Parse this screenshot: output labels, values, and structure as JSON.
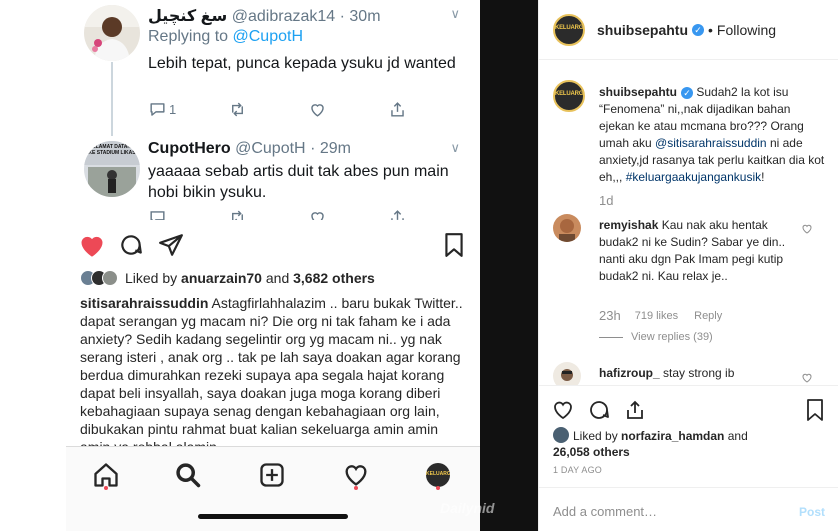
{
  "tweets": [
    {
      "name": "سغ كنچيل",
      "handle": "@adibrazak14",
      "time": "· 30m",
      "reply_prefix": "Replying to ",
      "reply_to": "@CupotH",
      "text": "Lebih tepat, punca kepada ysuku jd wanted",
      "replies": "1"
    },
    {
      "name": "CupotHero",
      "handle": "@CupotH",
      "time": "· 29m",
      "text": "yaaaaa sebab artis duit tak abes pun main hobi bikin ysuku.",
      "avatar_text": "SELAMAT DATANG KE STADIUM LIKAS"
    }
  ],
  "phone_post": {
    "liked_by_prefix": "Liked by ",
    "liked_user": "anuarzain70",
    "liked_and": " and ",
    "liked_count": "3,682 others",
    "caption_user": "sitisarahraissuddin",
    "caption_text": " Astagfirlahhalazim .. baru bukak Twitter.. dapat serangan yg macam ni? Die org ni tak faham ke i ada anxiety?  Sedih kadang segelintir org yg macam ni.. yg nak serang isteri , anak org .. tak pe lah saya doakan agar korang berdua dimurahkan rezeki supaya apa segala hajat korang dapat beli insyallah, saya doakan juga moga korang diberi kebahagiaan supaya  senag dengan kebahagiaan org lain, dibukakan pintu rahmat buat kalian sekeluarga amin amin amin ya robbal alamin..",
    "nav_logo": "KELUARGA"
  },
  "watermark": "Dailynid",
  "right_panel": {
    "header_user": "shuibsepahtu",
    "following_sep": " • ",
    "following": "Following",
    "logo_text": "KELUARGA",
    "caption_user": "shuibsepahtu",
    "caption_text_1": " Sudah2 la kot isu “Fenomena” ni,,nak dijadikan bahan ejekan ke atau mcmana bro??? Orang umah aku ",
    "caption_mention": "@sitisarahraissuddin",
    "caption_text_2": " ni ade anxiety,jd rasanya tak perlu kaitkan dia kot eh,,, ",
    "caption_tag": "#keluargaakujangankusik",
    "caption_text_3": "!",
    "caption_time": "1d",
    "comments": [
      {
        "user": "remyishak",
        "text": " Kau nak aku hentak budak2 ni ke Sudin? Sabar ye din.. nanti aku dgn Pak Imam pegi kutip budak2 ni. Kau relax je..",
        "time": "23h",
        "likes": "719 likes",
        "reply": "Reply",
        "view_replies": "View replies (39)"
      },
      {
        "user": "hafizroup_",
        "text": " stay strong ib"
      }
    ],
    "liked_by_prefix": "Liked by ",
    "liked_user": "norfazira_hamdan",
    "liked_and": " and ",
    "liked_count": "26,058 others",
    "time_ago": "1 DAY AGO",
    "add_comment_placeholder": "Add a comment…",
    "post_label": "Post"
  }
}
